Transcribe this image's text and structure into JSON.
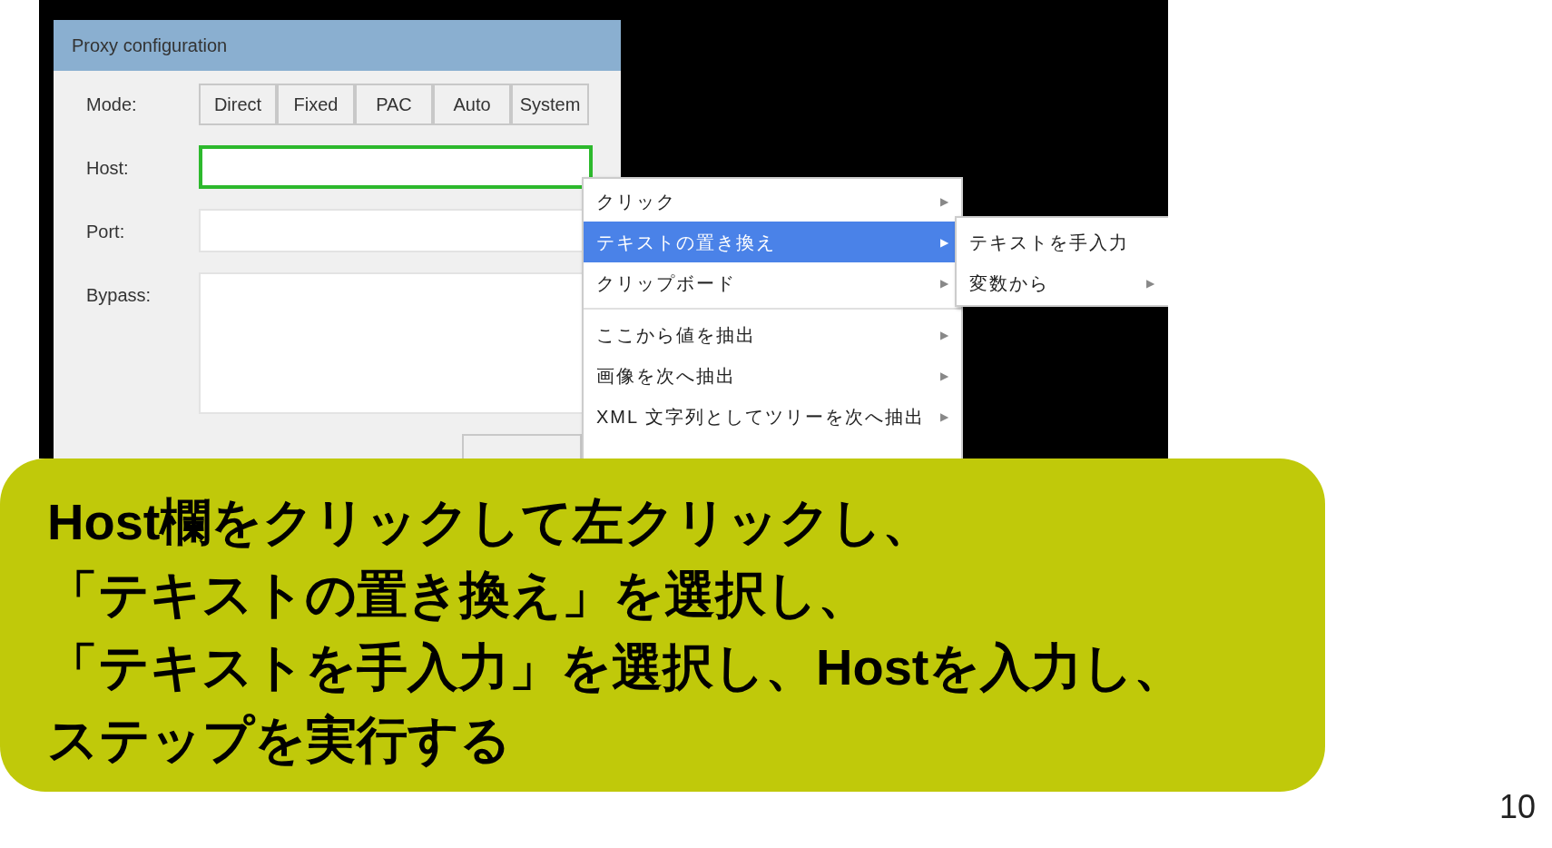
{
  "dialog": {
    "title": "Proxy configuration",
    "mode_label": "Mode:",
    "mode_buttons": [
      "Direct",
      "Fixed",
      "PAC",
      "Auto",
      "System"
    ],
    "fields": [
      {
        "label": "Host:",
        "focused": true,
        "kind": "line"
      },
      {
        "label": "Port:",
        "focused": false,
        "kind": "line"
      },
      {
        "label": "Bypass:",
        "focused": false,
        "kind": "area"
      }
    ]
  },
  "context_menu": {
    "items": [
      {
        "kind": "item",
        "label": "クリック",
        "selected": false,
        "arrow": "▶"
      },
      {
        "kind": "item",
        "label": "テキストの置き換え",
        "selected": true,
        "arrow": "▶"
      },
      {
        "kind": "item",
        "label": "クリップボード",
        "selected": false,
        "arrow": "▶"
      },
      {
        "kind": "separator"
      },
      {
        "kind": "item",
        "label": "ここから値を抽出",
        "selected": false,
        "arrow": "▶"
      },
      {
        "kind": "item",
        "label": "画像を次へ抽出",
        "selected": false,
        "arrow": "▶"
      },
      {
        "kind": "item",
        "label": "XML 文字列としてツリーを次へ抽出",
        "selected": false,
        "arrow": "▶"
      }
    ]
  },
  "submenu": {
    "items": [
      {
        "label": "テキストを手入力"
      },
      {
        "label": "変数から",
        "arrow": "▶"
      }
    ]
  },
  "callout": {
    "lines": [
      "Host欄をクリックして左クリックし、",
      "「テキストの置き換え」を選択し、",
      "「テキストを手入力」を選択し、Hostを入力し、",
      "ステップを実行する"
    ]
  },
  "page_number": "10"
}
